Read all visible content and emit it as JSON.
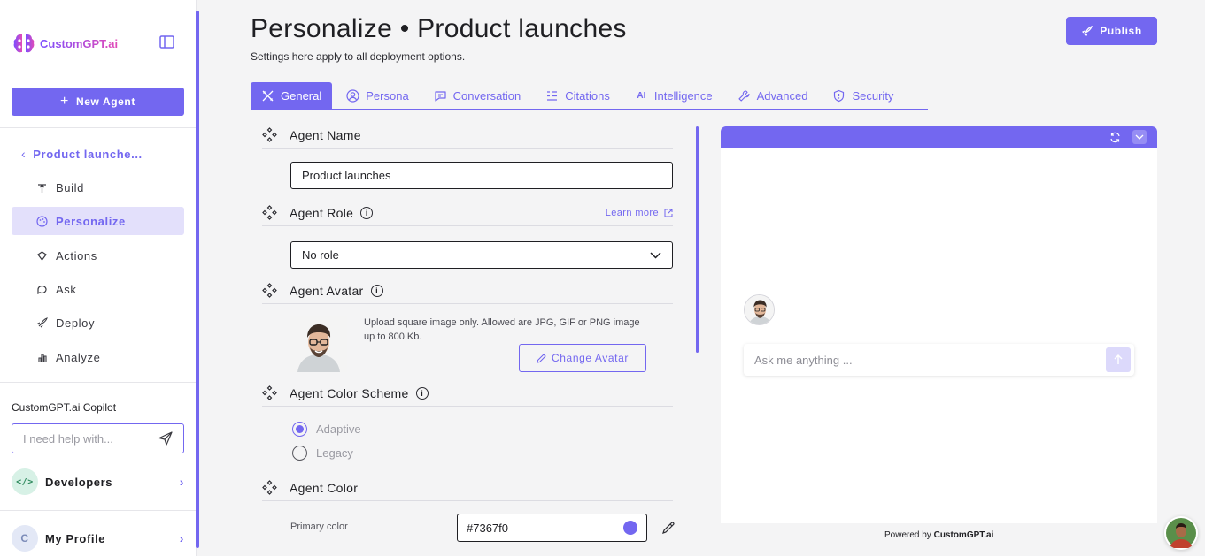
{
  "sidebar": {
    "logo_text": "CustomGPT.ai",
    "new_agent_label": "New Agent",
    "back_label": "Product launche...",
    "items": [
      {
        "label": "Build",
        "icon": "build-icon"
      },
      {
        "label": "Personalize",
        "icon": "palette-icon"
      },
      {
        "label": "Actions",
        "icon": "actions-icon"
      },
      {
        "label": "Ask",
        "icon": "chat-icon"
      },
      {
        "label": "Deploy",
        "icon": "rocket-icon"
      },
      {
        "label": "Analyze",
        "icon": "chart-icon"
      }
    ],
    "active_item": "Personalize",
    "copilot_title": "CustomGPT.ai Copilot",
    "copilot_placeholder": "I need help with...",
    "developers_label": "Developers",
    "profile_label": "My Profile",
    "profile_initial": "C"
  },
  "header": {
    "title": "Personalize • Product launches",
    "subtitle": "Settings here apply to all deployment options.",
    "publish_label": "Publish"
  },
  "tabs": [
    {
      "label": "General",
      "icon": "general-icon",
      "active": true
    },
    {
      "label": "Persona",
      "icon": "persona-icon"
    },
    {
      "label": "Conversation",
      "icon": "conversation-icon"
    },
    {
      "label": "Citations",
      "icon": "citations-icon"
    },
    {
      "label": "Intelligence",
      "icon": "ai-icon"
    },
    {
      "label": "Advanced",
      "icon": "wrench-icon"
    },
    {
      "label": "Security",
      "icon": "shield-icon"
    }
  ],
  "form": {
    "agent_name_label": "Agent Name",
    "agent_name_value": "Product launches",
    "agent_role_label": "Agent Role",
    "learn_more": "Learn more",
    "agent_role_value": "No role",
    "agent_avatar_label": "Agent Avatar",
    "avatar_desc": "Upload square image only. Allowed are JPG, GIF or PNG image up to 800 Kb.",
    "change_avatar_label": "Change Avatar",
    "color_scheme_label": "Agent Color Scheme",
    "scheme_options": [
      "Adaptive",
      "Legacy"
    ],
    "scheme_selected": "Adaptive",
    "agent_color_label": "Agent Color",
    "primary_color_label": "Primary color",
    "primary_color_value": "#7367f0"
  },
  "preview": {
    "chat_placeholder": "Ask me anything ...",
    "powered_prefix": "Powered by",
    "powered_brand": "CustomGPT.ai"
  },
  "colors": {
    "accent": "#7367f0",
    "active_bg": "#e3e0fb"
  }
}
